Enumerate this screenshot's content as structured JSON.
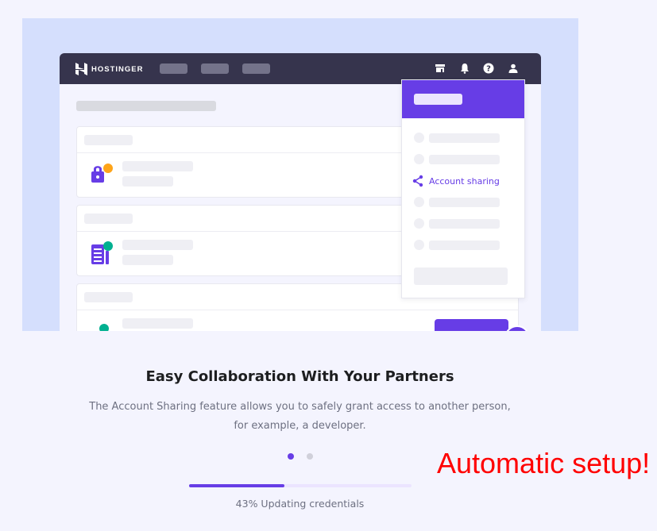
{
  "illustration": {
    "brand": "HOSTINGER",
    "nav_placeholders": 3,
    "top_icons": [
      "store-icon",
      "bell-icon",
      "help-icon",
      "user-icon"
    ],
    "dropdown": {
      "active_item": "Account sharing",
      "active_icon": "share-icon"
    },
    "cards": [
      {
        "icon": "lock-icon",
        "badge_color": "#fea419"
      },
      {
        "icon": "invoice-icon",
        "badge_color": "#00b090"
      },
      {
        "icon": "item-icon",
        "badge_color": "#00b090"
      }
    ],
    "colors": {
      "accent": "#673de6",
      "topbar": "#36344d",
      "background": "#d5dffd"
    }
  },
  "content": {
    "title": "Easy Collaboration With Your Partners",
    "description_line1": "The Account Sharing feature allows you to safely grant access to another person,",
    "description_line2": "for example, a developer."
  },
  "carousel": {
    "slides": 2,
    "active_index": 0
  },
  "progress": {
    "percent": 43,
    "label": "43% Updating credentials"
  },
  "overlay_text": "Automatic setup!"
}
